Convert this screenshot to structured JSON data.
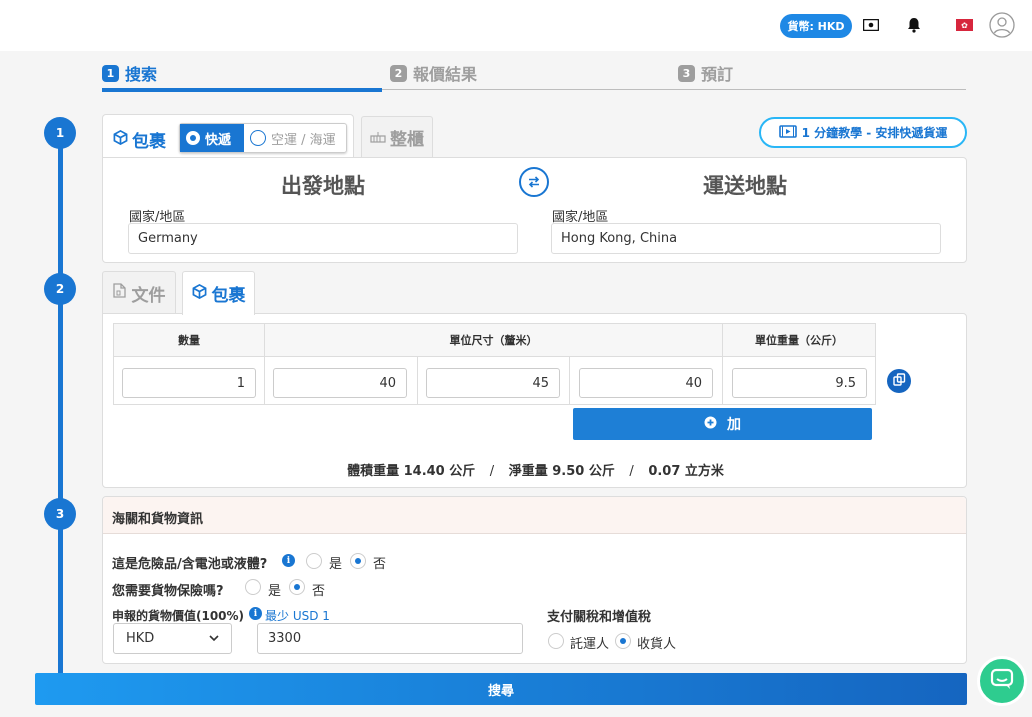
{
  "header": {
    "currency_label": "貨幣: HKD",
    "icons": [
      "cash-icon",
      "bell-icon",
      "hk-flag-icon",
      "user-avatar-icon"
    ]
  },
  "stepper": {
    "steps": [
      {
        "num": "1",
        "label": "搜索"
      },
      {
        "num": "2",
        "label": "報價結果"
      },
      {
        "num": "3",
        "label": "預訂"
      }
    ]
  },
  "progress": {
    "circles": [
      "1",
      "2",
      "3"
    ]
  },
  "shipment": {
    "parcel_tab": "包裹",
    "mode_express": "快遞",
    "mode_air_sea": "空運 / 海運",
    "fcl_tab": "整櫃",
    "tutorial": "1 分鐘教學 - 安排快遞貨運",
    "origin_title": "出發地點",
    "dest_title": "運送地點",
    "origin_label": "國家/地區",
    "origin_value": "Germany",
    "dest_label": "國家/地區",
    "dest_value": "Hong Kong, China"
  },
  "package": {
    "doc_tab": "文件",
    "pkg_tab": "包裹",
    "headers": {
      "qty": "數量",
      "dims": "單位尺寸（釐米）",
      "weight": "單位重量（公斤）"
    },
    "row": {
      "qty": "1",
      "length": "40",
      "width": "45",
      "height": "40",
      "weight": "9.5"
    },
    "add_label": "加",
    "summary": {
      "vol_label": "體積重量",
      "vol_value": "14.40 公斤",
      "net_label": "淨重量",
      "net_value": "9.50 公斤",
      "cbm_value": "0.07 立方米",
      "sep": "/"
    }
  },
  "customs": {
    "title": "海關和貨物資訊",
    "dangerous_q": "這是危險品/含電池或液體?",
    "insurance_q": "您需要貨物保險嗎?",
    "yes": "是",
    "no": "否",
    "declared_label": "申報的貨物價值(100%)",
    "min_text": "最少 USD 1",
    "currency_select": "HKD",
    "declared_value": "3300",
    "duty_label": "支付關稅和增值稅",
    "shipper": "託運人",
    "receiver": "收貨人",
    "dangerous_selected": "no",
    "insurance_selected": "no",
    "duty_selected": "receiver"
  },
  "search_label": "搜尋",
  "colors": {
    "primary": "#1976d2",
    "chat": "#2ecc8f",
    "accent_border": "#29b6f6"
  }
}
